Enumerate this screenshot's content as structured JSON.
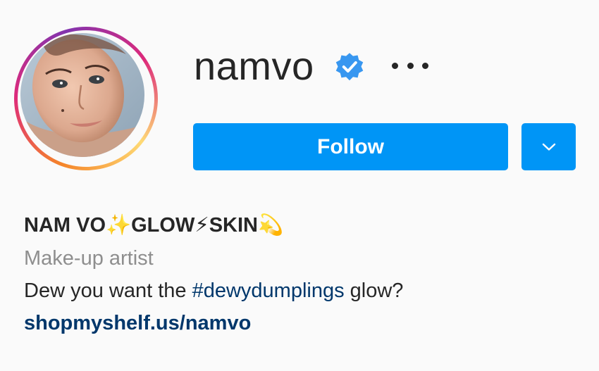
{
  "profile": {
    "username": "namvo",
    "full_name": {
      "part1": "NAM VO",
      "emoji1": "✨",
      "part2": "GLOW",
      "emoji2": "⚡",
      "part3": "SKIN",
      "emoji3": "💫"
    },
    "category": "Make-up artist",
    "bio": {
      "before": "Dew you want the ",
      "hashtag": "#dewydumplings",
      "after": " glow?"
    },
    "link": "shopmyshelf.us/namvo"
  },
  "actions": {
    "follow_label": "Follow"
  },
  "icons": {
    "verified": "verified-badge-icon",
    "more": "more-options-icon",
    "dropdown": "chevron-down-icon"
  },
  "colors": {
    "primary": "#0095f6",
    "verified": "#3897f0",
    "link": "#00376b",
    "text": "#262626",
    "secondary_text": "#8e8e8e"
  }
}
